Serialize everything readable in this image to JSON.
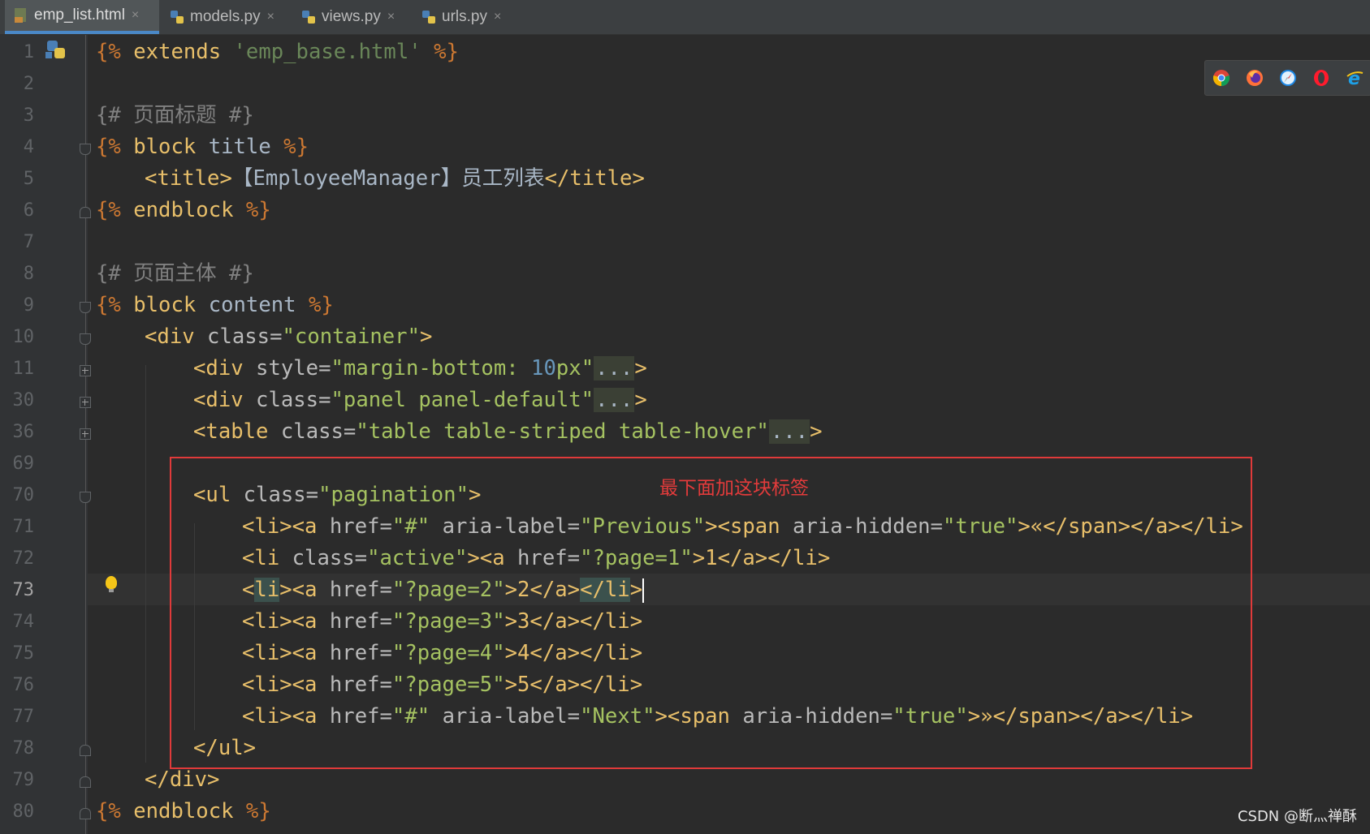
{
  "tabs": [
    {
      "label": "emp_list.html",
      "icon": "html-file-icon",
      "active": true
    },
    {
      "label": "models.py",
      "icon": "python-file-icon",
      "active": false
    },
    {
      "label": "views.py",
      "icon": "python-file-icon",
      "active": false
    },
    {
      "label": "urls.py",
      "icon": "python-file-icon",
      "active": false
    }
  ],
  "tab_close_glyph": "×",
  "line_numbers": [
    "1",
    "2",
    "3",
    "4",
    "5",
    "6",
    "7",
    "8",
    "9",
    "10",
    "11",
    "30",
    "36",
    "69",
    "70",
    "71",
    "72",
    "73",
    "74",
    "75",
    "76",
    "77",
    "78",
    "79",
    "80"
  ],
  "current_line": "73",
  "code": {
    "l1": {
      "a": "{%",
      "b": " extends ",
      "c": "'emp_base.html'",
      "d": " %}"
    },
    "l3": {
      "a": "{# 页面标题 #}"
    },
    "l4": {
      "a": "{%",
      "b": " block ",
      "c": "title",
      "d": " %}"
    },
    "l5": {
      "a": "<title>",
      "b": "【EmployeeManager】员工列表",
      "c": "</title>"
    },
    "l6": {
      "a": "{%",
      "b": " endblock ",
      "d": "%}"
    },
    "l8": {
      "a": "{# 页面主体 #}"
    },
    "l9": {
      "a": "{%",
      "b": " block ",
      "c": "content",
      "d": " %}"
    },
    "l10": {
      "a": "<div ",
      "b": "class=",
      "c": "\"container\"",
      "d": ">"
    },
    "l11": {
      "a": "<div ",
      "b": "style=",
      "c": "\"margin-bottom: ",
      "n": "10",
      "c2": "px\"",
      "f": "...",
      "d": ">"
    },
    "l30": {
      "a": "<div ",
      "b": "class=",
      "c": "\"panel panel-default\"",
      "f": "...",
      "d": ">"
    },
    "l36": {
      "a": "<table ",
      "b": "class=",
      "c": "\"table table-striped table-hover\"",
      "f": "...",
      "d": ">"
    },
    "l70": {
      "a": "<ul ",
      "b": "class=",
      "c": "\"pagination\"",
      "d": ">"
    },
    "l71": {
      "a": "<li><a ",
      "b": "href=",
      "c": "\"#\" ",
      "b2": "aria-label=",
      "c2": "\"Previous\"",
      "d": "><span ",
      "b3": "aria-hidden=",
      "c3": "\"true\"",
      "e": ">«</span></a></li>"
    },
    "l72": {
      "a": "<li ",
      "b": "class=",
      "c": "\"active\"",
      "d": "><a ",
      "b2": "href=",
      "c2": "\"?page=1\"",
      "e": ">1</a></li>"
    },
    "l73": {
      "a1": "<",
      "a2": "li",
      "a3": "><a ",
      "b": "href=",
      "c": "\"?page=2\"",
      "e1": ">2</a>",
      "e2": "</li",
      "e3": ">"
    },
    "l74": {
      "a": "<li><a ",
      "b": "href=",
      "c": "\"?page=3\"",
      "e": ">3</a></li>"
    },
    "l75": {
      "a": "<li><a ",
      "b": "href=",
      "c": "\"?page=4\"",
      "e": ">4</a></li>"
    },
    "l76": {
      "a": "<li><a ",
      "b": "href=",
      "c": "\"?page=5\"",
      "e": ">5</a></li>"
    },
    "l77": {
      "a": "<li><a ",
      "b": "href=",
      "c": "\"#\" ",
      "b2": "aria-label=",
      "c2": "\"Next\"",
      "d": "><span ",
      "b3": "aria-hidden=",
      "c3": "\"true\"",
      "e": ">»</span></a></li>"
    },
    "l78": {
      "a": "</ul>"
    },
    "l79": {
      "a": "</div>"
    },
    "l80": {
      "a": "{%",
      "b": " endblock ",
      "d": "%}"
    }
  },
  "annotation": "最下面加这块标签",
  "annotation_color": "#e23b3b",
  "browser_icons": [
    "chrome-icon",
    "firefox-icon",
    "safari-icon",
    "opera-icon",
    "ie-icon"
  ],
  "watermark": "CSDN @断灬禅酥"
}
